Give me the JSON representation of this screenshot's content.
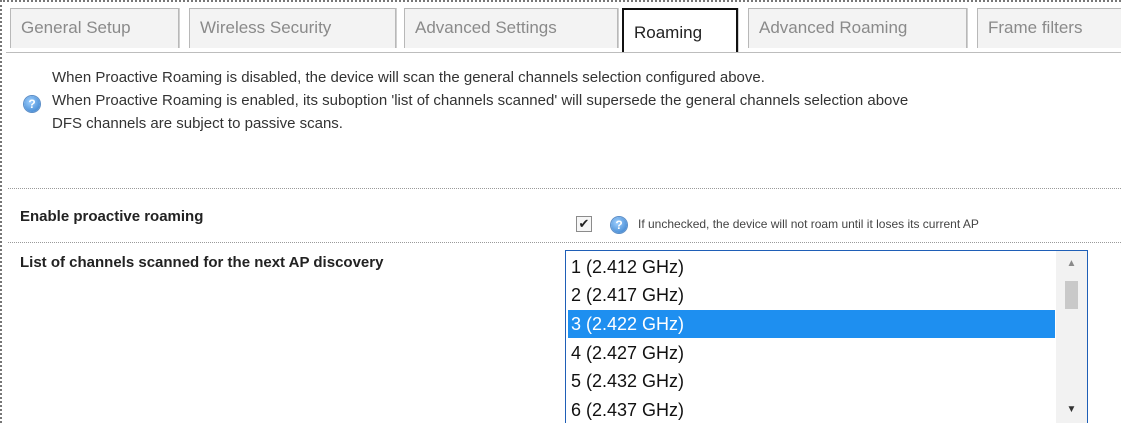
{
  "tabs": [
    {
      "label": "General Setup",
      "active": false
    },
    {
      "label": "Wireless Security",
      "active": false
    },
    {
      "label": "Advanced Settings",
      "active": false
    },
    {
      "label": "Roaming",
      "active": true
    },
    {
      "label": "Advanced Roaming",
      "active": false
    },
    {
      "label": "Frame filters",
      "active": false
    }
  ],
  "notice": {
    "icon": "help-icon",
    "lines": [
      "When Proactive Roaming is disabled, the device will scan the general channels selection configured above.",
      "When Proactive Roaming is enabled, its suboption 'list of channels scanned' will supersede the general channels selection above",
      "DFS channels are subject to passive scans."
    ]
  },
  "proactive_roaming": {
    "label": "Enable proactive roaming",
    "checked": true,
    "checkmark": "✔",
    "help_icon": "help-icon",
    "hint": "If unchecked, the device will not roam until it loses its current AP"
  },
  "channels": {
    "label": "List of channels scanned for the next AP discovery",
    "options": [
      "1 (2.412 GHz)",
      "2 (2.417 GHz)",
      "3 (2.422 GHz)",
      "4 (2.427 GHz)",
      "5 (2.432 GHz)",
      "6 (2.437 GHz)"
    ],
    "selected_index": 2,
    "scroll_up": "▲",
    "scroll_down": "▼"
  },
  "colors": {
    "selection": "#1e8ff0",
    "focus_border": "#1f5fb7",
    "active_tab_border": "#111111"
  },
  "help_glyph": "?"
}
